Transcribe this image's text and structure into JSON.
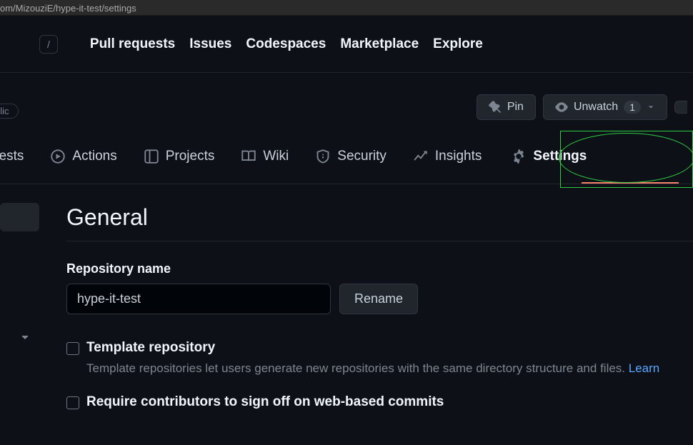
{
  "url": "om/MizouziE/hype-it-test/settings",
  "slash_key": "/",
  "top_nav": {
    "pull_requests": "Pull requests",
    "issues": "Issues",
    "codespaces": "Codespaces",
    "marketplace": "Marketplace",
    "explore": "Explore"
  },
  "repo_actions": {
    "visibility": "olic",
    "pin": "Pin",
    "unwatch": "Unwatch",
    "watch_count": "1"
  },
  "tabs": {
    "pull_requests_partial": "uests",
    "actions": "Actions",
    "projects": "Projects",
    "wiki": "Wiki",
    "security": "Security",
    "insights": "Insights",
    "settings": "Settings"
  },
  "settings_page": {
    "title": "General",
    "repo_name_label": "Repository name",
    "repo_name_value": "hype-it-test",
    "rename_btn": "Rename",
    "template_label": "Template repository",
    "template_desc": "Template repositories let users generate new repositories with the same directory structure and files. ",
    "learn_link": "Learn",
    "signoff_label": "Require contributors to sign off on web-based commits"
  }
}
